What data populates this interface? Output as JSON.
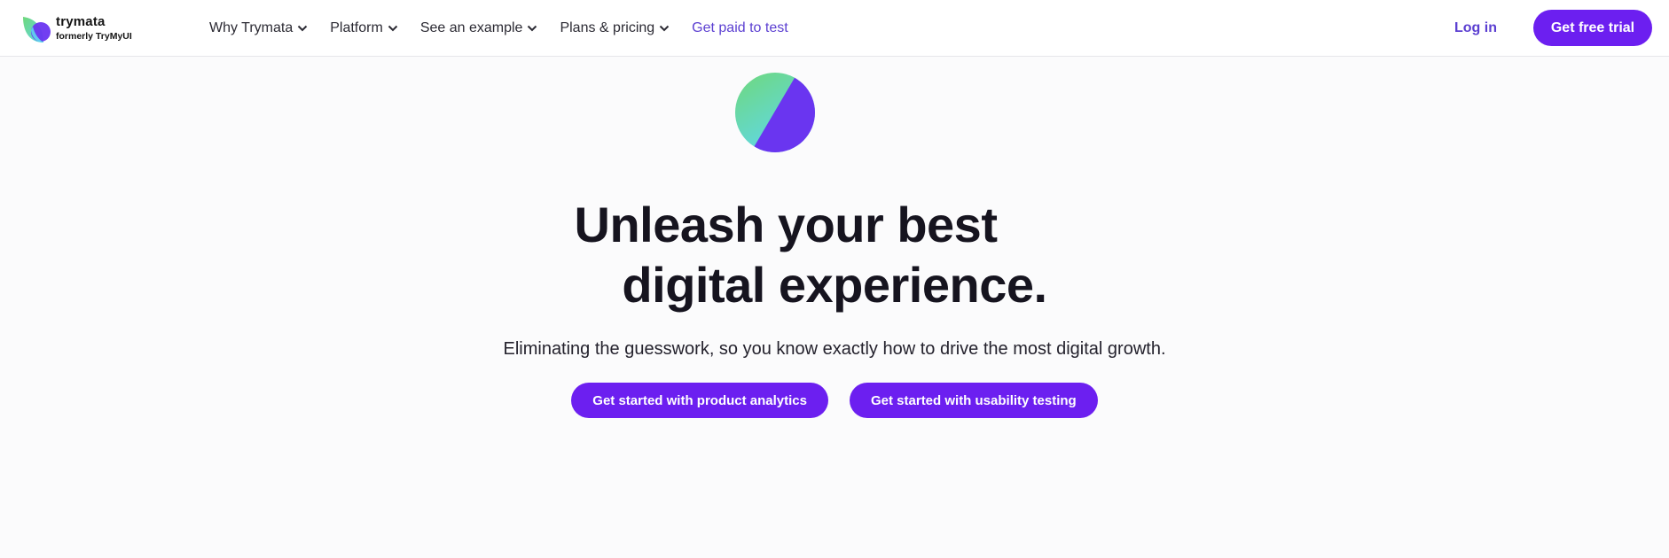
{
  "header": {
    "brand_name": "trymata",
    "brand_sub": "formerly TryMyUI",
    "nav": [
      {
        "label": "Why Trymata",
        "has_dropdown": true
      },
      {
        "label": "Platform",
        "has_dropdown": true
      },
      {
        "label": "See an example",
        "has_dropdown": true
      },
      {
        "label": "Plans & pricing",
        "has_dropdown": true
      },
      {
        "label": "Get paid to test",
        "has_dropdown": false
      }
    ],
    "login_label": "Log in",
    "trial_label": "Get free trial"
  },
  "hero": {
    "headline_line1": "Unleash your best",
    "headline_line2": "digital experience.",
    "subhead": "Eliminating the guesswork, so you know exactly how to drive the most digital growth.",
    "cta_analytics": "Get started with product analytics",
    "cta_usability": "Get started with usability testing"
  },
  "colors": {
    "accent": "#6c1ff0",
    "link": "#5b3fd1",
    "logo_green": "#6fd87a",
    "logo_cyan": "#5fd8ee",
    "logo_purple": "#6a35f0"
  },
  "icons": {
    "brand": "trymata-logo-icon",
    "chevron": "chevron-down-icon",
    "hero": "trymata-orb-icon"
  }
}
